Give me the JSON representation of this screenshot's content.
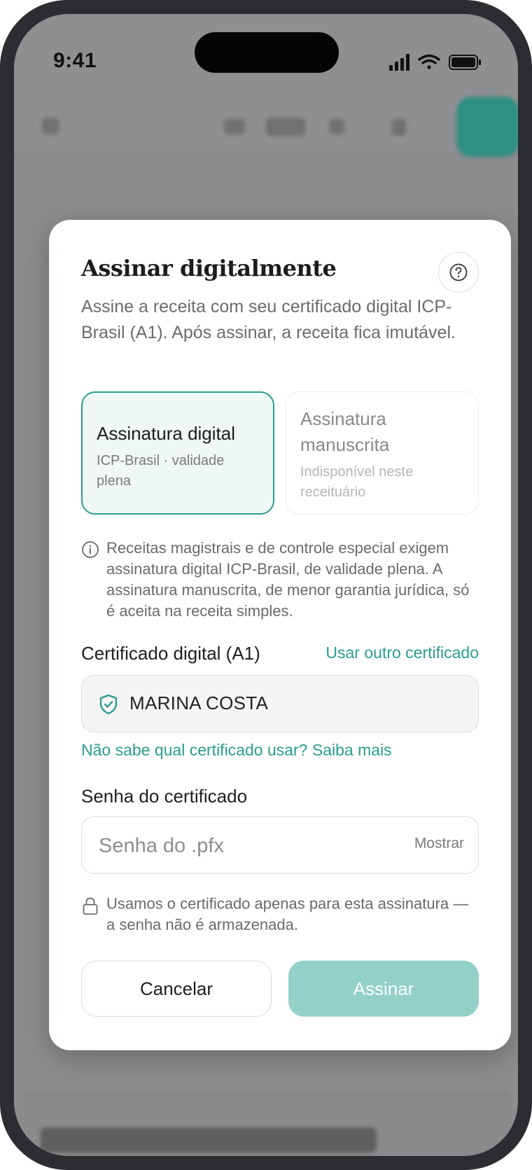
{
  "status_bar": {
    "time": "9:41"
  },
  "dialog": {
    "title": "Assinar digitalmente",
    "description": "Assine a receita com seu certificado digital ICP-Brasil (A1). Após assinar, a receita fica imutável.",
    "options": [
      {
        "title": "Assinatura digital",
        "subtitle": "ICP-Brasil · validade plena",
        "selected": true
      },
      {
        "title": "Assinatura manuscrita",
        "subtitle": "Indisponível neste receituário",
        "selected": false
      }
    ],
    "notice": "Receitas magistrais e de controle especial exigem assinatura digital ICP-Brasil, de validade plena. A assinatura manuscrita, de menor garantia jurídica, só é aceita na receita simples.",
    "certificate": {
      "label": "Certificado digital (A1)",
      "change_link": "Usar outro certificado",
      "name": "MARINA COSTA",
      "help_link": "Não sabe qual certificado usar? Saiba mais"
    },
    "password": {
      "label": "Senha do certificado",
      "placeholder": "Senha do .pfx",
      "value": "",
      "show_label": "Mostrar"
    },
    "security_note": "Usamos o certificado apenas para esta assinatura — a senha não é armazenada.",
    "buttons": {
      "cancel": "Cancelar",
      "sign": "Assinar"
    }
  },
  "colors": {
    "accent": "#2a9d8f",
    "accent_disabled": "#92d0c8",
    "selected_bg": "#f0f8f7"
  }
}
